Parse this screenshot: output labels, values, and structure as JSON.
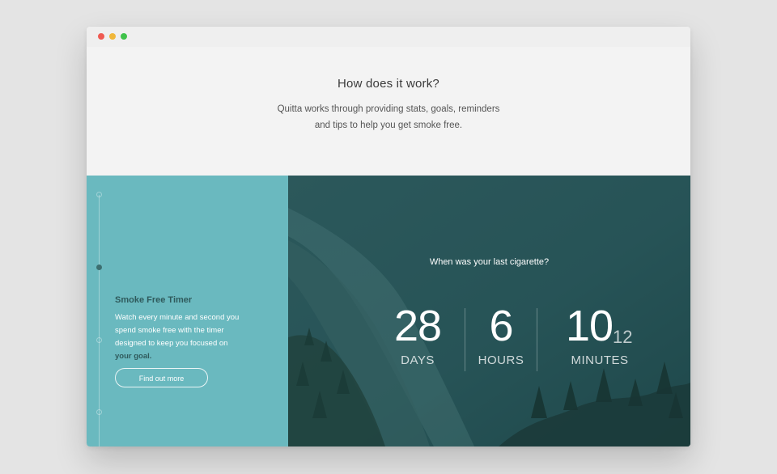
{
  "window": {
    "traffic_lights": [
      "#ef5a52",
      "#f0b73a",
      "#3fc24a"
    ]
  },
  "intro": {
    "title": "How does it work?",
    "description_line1": "Quitta works through providing stats, goals, reminders",
    "description_line2": "and tips to help you get smoke free."
  },
  "feature": {
    "title": "Smoke Free Timer",
    "description": "Watch every minute and second you spend smoke free with the timer designed to keep you focused on",
    "description_emphasis": "your goal.",
    "button_label": "Find out more"
  },
  "timer": {
    "question": "When was your last cigarette?",
    "days_value": "28",
    "days_label": "DAYS",
    "hours_value": "6",
    "hours_label": "HOURS",
    "minutes_value": "10",
    "minutes_label": "MINUTES",
    "seconds_value": "12"
  },
  "colors": {
    "sidebar": "#6ab9bf",
    "accent_dark": "#2f5a5c",
    "hero_overlay": "#2d5a5d"
  }
}
